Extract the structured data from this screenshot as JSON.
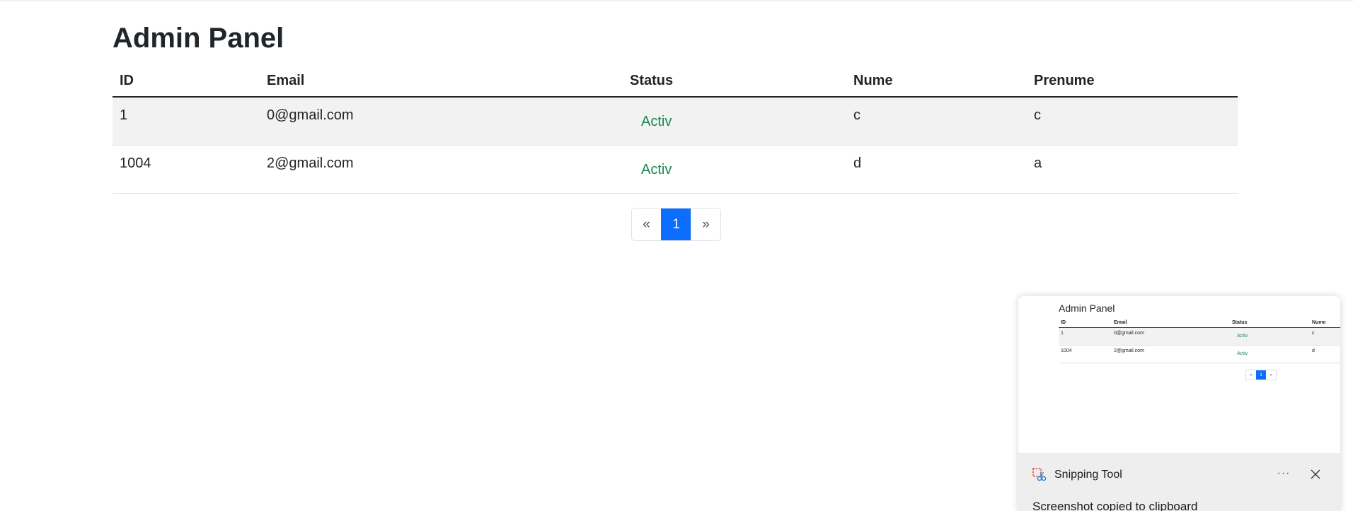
{
  "page": {
    "title": "Admin Panel"
  },
  "table": {
    "headers": [
      "ID",
      "Email",
      "Status",
      "Nume",
      "Prenume"
    ],
    "rows": [
      {
        "id": "1",
        "email": "0@gmail.com",
        "status": "Activ",
        "nume": "c",
        "prenume": "c"
      },
      {
        "id": "1004",
        "email": "2@gmail.com",
        "status": "Activ",
        "nume": "d",
        "prenume": "a"
      }
    ]
  },
  "pagination": {
    "prev": "«",
    "current": "1",
    "next": "»"
  },
  "colors": {
    "accent": "#0d6efd",
    "status_active": "#198754",
    "stripe": "#f2f2f2"
  },
  "notification": {
    "app_name": "Snipping Tool",
    "message": "Screenshot copied to clipboard",
    "more_icon": "ellipsis-icon",
    "close_icon": "close-icon",
    "app_icon": "snipping-tool-icon",
    "thumbnail": {
      "title": "Admin Panel",
      "headers": [
        "ID",
        "Email",
        "Status",
        "Nume"
      ],
      "rows": [
        {
          "id": "1",
          "email": "0@gmail.com",
          "status": "Activ",
          "nume": "c"
        },
        {
          "id": "1004",
          "email": "2@gmail.com",
          "status": "Activ",
          "nume": "d"
        }
      ],
      "pager": [
        "«",
        "1",
        "»"
      ]
    }
  }
}
